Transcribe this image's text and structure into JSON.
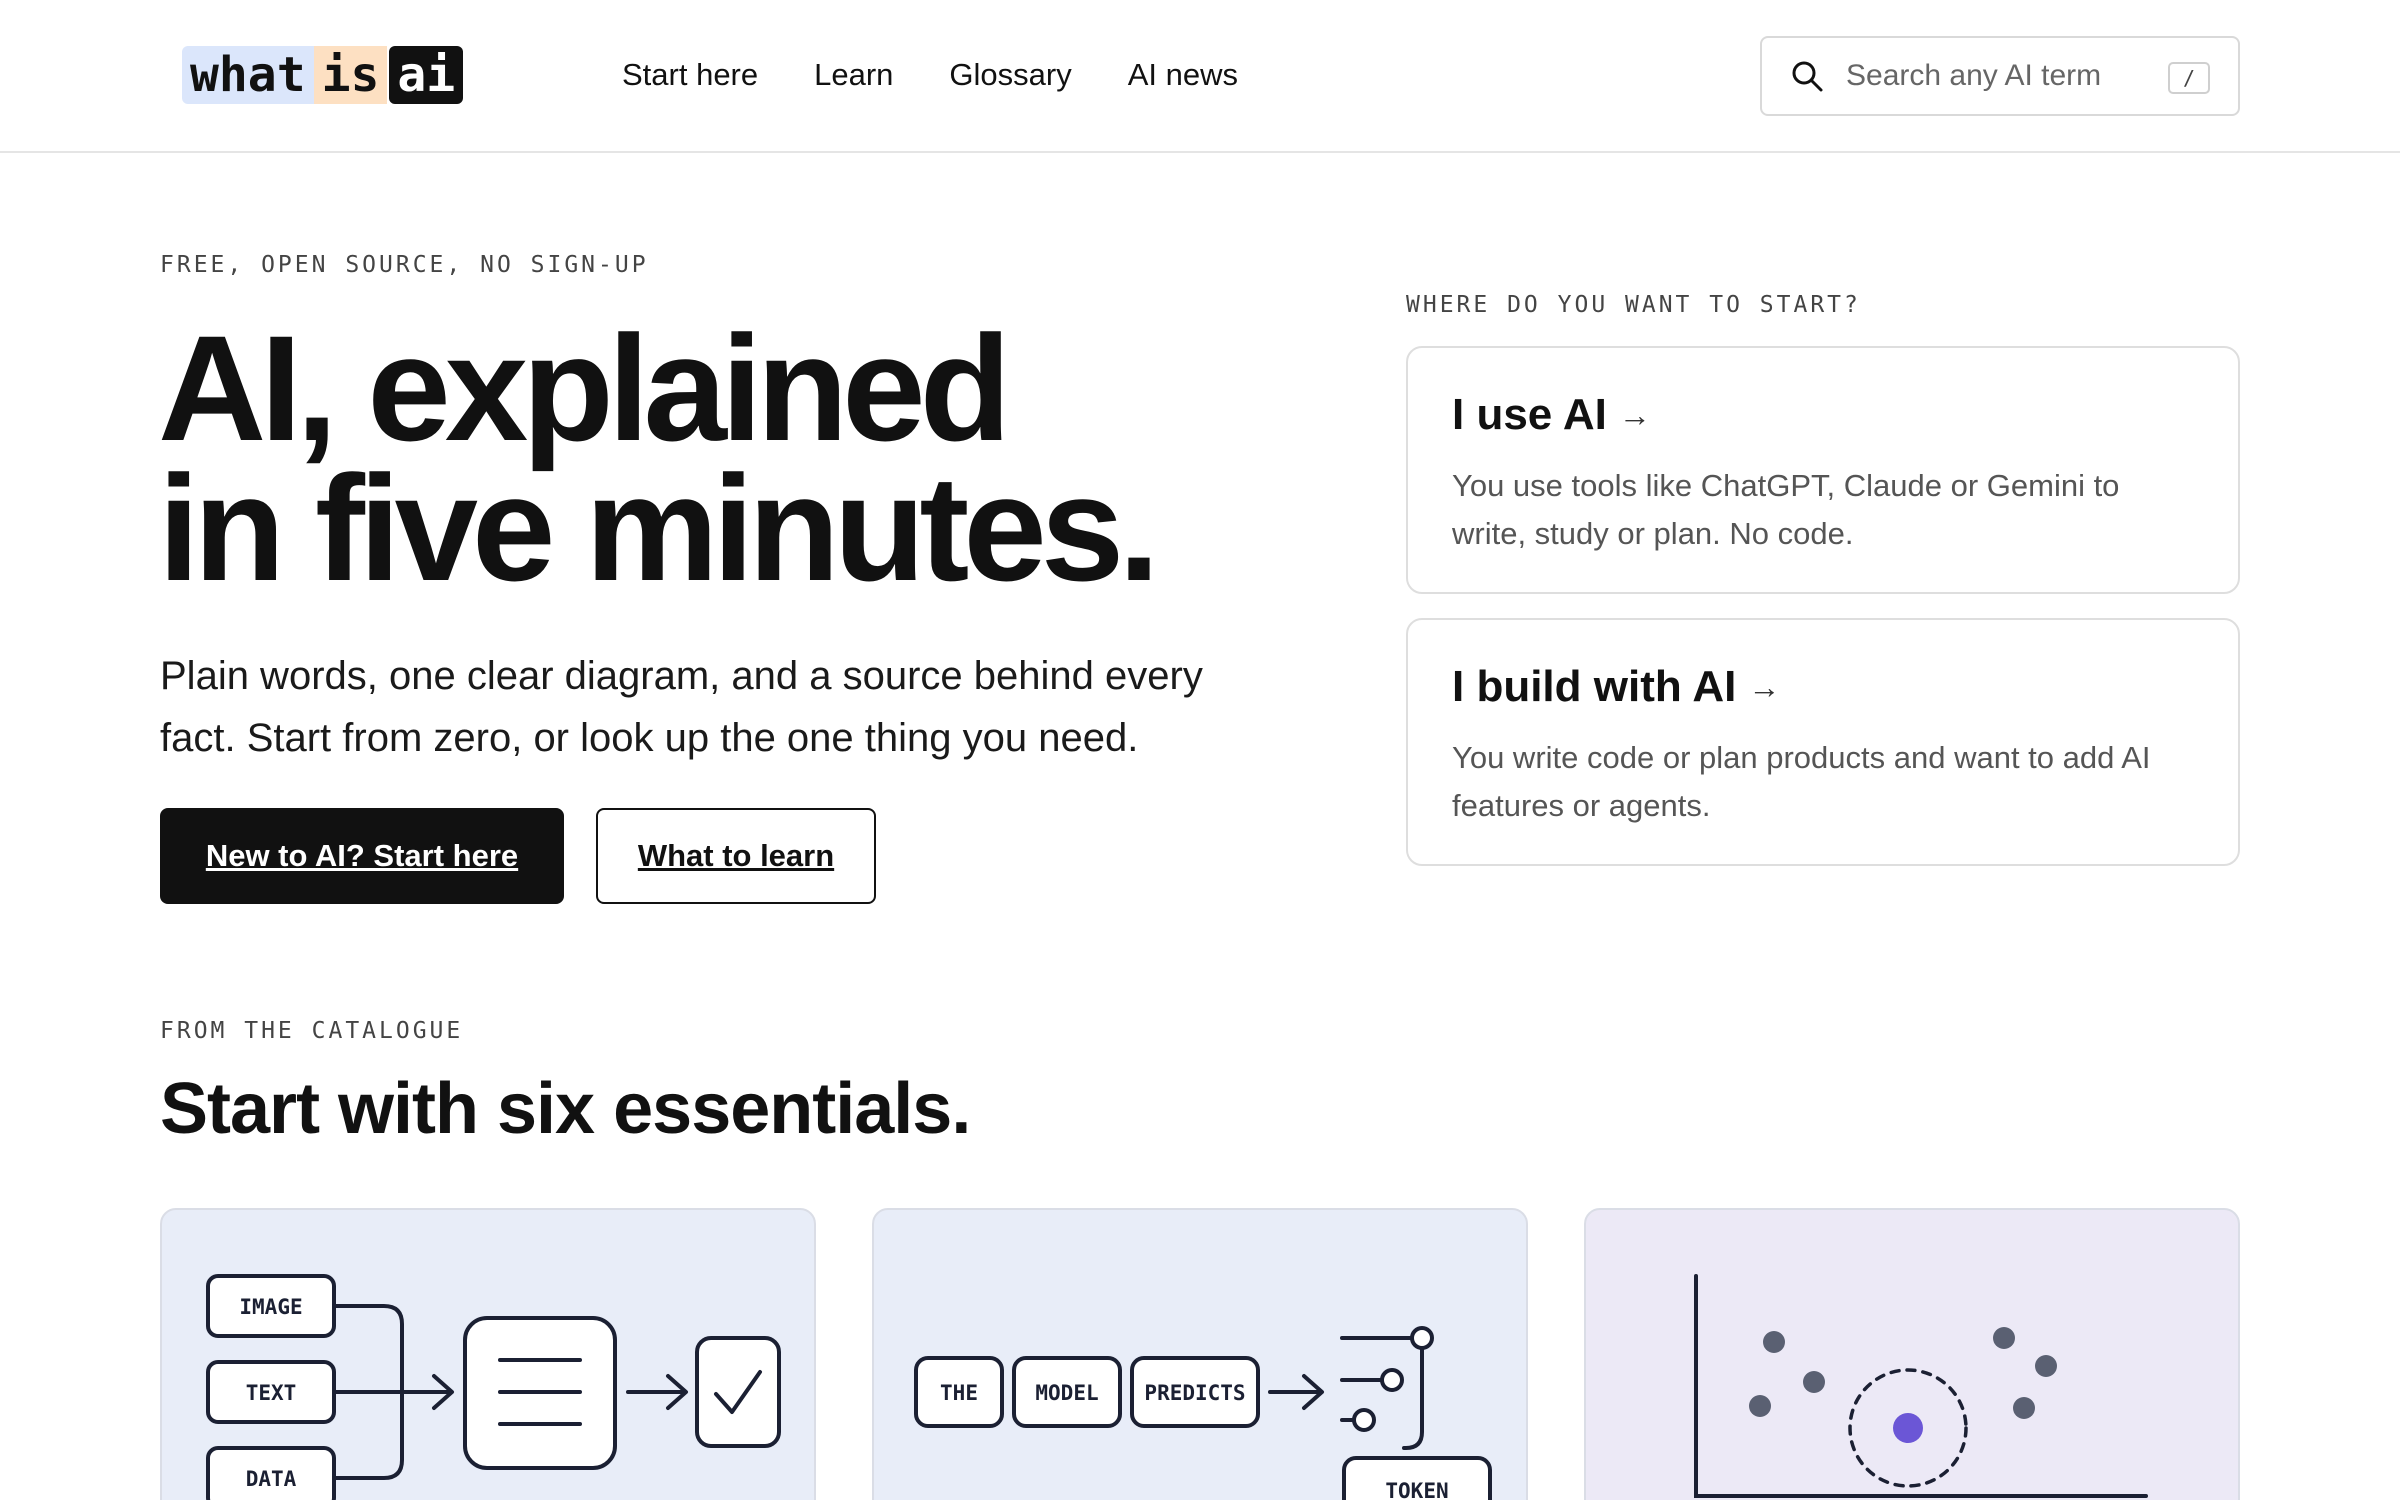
{
  "header": {
    "logo": [
      "what",
      "is",
      "ai"
    ],
    "nav": [
      "Start here",
      "Learn",
      "Glossary",
      "AI news"
    ],
    "search": {
      "placeholder": "Search any AI term",
      "shortcut": "/"
    }
  },
  "hero": {
    "eyebrow": "FREE, OPEN SOURCE, NO SIGN-UP",
    "title_line1": "AI, explained",
    "title_line2": "in five minutes.",
    "subtitle": "Plain words, one clear diagram, and a source behind every fact. Start from zero, or look up the one thing you need.",
    "primary_cta": "New to AI? Start here",
    "secondary_cta": "What to learn"
  },
  "start": {
    "eyebrow": "WHERE DO YOU WANT TO START?",
    "options": [
      {
        "title": "I use AI",
        "arrow": "→",
        "desc": "You use tools like ChatGPT, Claude or Gemini to write, study or plan. No code."
      },
      {
        "title": "I build with AI",
        "arrow": "→",
        "desc": "You write code or plan products and want to add AI features or agents."
      }
    ]
  },
  "catalogue": {
    "eyebrow": "FROM THE CATALOGUE",
    "title": "Start with six essentials.",
    "card1_labels": [
      "IMAGE",
      "TEXT",
      "DATA"
    ],
    "card2_labels": [
      "THE",
      "MODEL",
      "PREDICTS",
      "TOKEN"
    ]
  },
  "colors": {
    "accent_purple": "#6b56d6",
    "dark": "#111111",
    "card_blue": "#e8edf8",
    "card_purple": "#ece9f6",
    "logo_blue": "#dbe6fb",
    "logo_orange": "#fde0c2"
  }
}
